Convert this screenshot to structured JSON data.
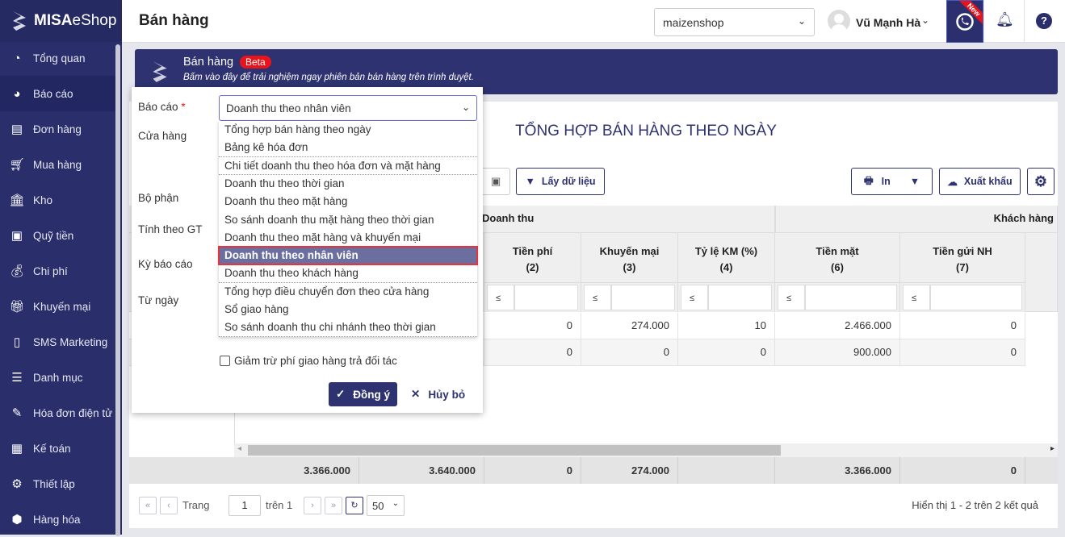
{
  "brand": {
    "logo_text_bold": "MISA",
    "logo_text": "eShop"
  },
  "sidebar": {
    "items": [
      {
        "label": "Tổng quan",
        "icon": "dashboard-icon"
      },
      {
        "label": "Báo cáo",
        "icon": "pie-chart-icon",
        "active": true
      },
      {
        "label": "Đơn hàng",
        "icon": "order-icon"
      },
      {
        "label": "Mua hàng",
        "icon": "cart-icon"
      },
      {
        "label": "Kho",
        "icon": "warehouse-icon"
      },
      {
        "label": "Quỹ tiền",
        "icon": "safe-icon"
      },
      {
        "label": "Chi phí",
        "icon": "money-bag-icon"
      },
      {
        "label": "Khuyến mại",
        "icon": "gift-icon"
      },
      {
        "label": "SMS Marketing",
        "icon": "phone-icon"
      },
      {
        "label": "Danh mục",
        "icon": "list-icon"
      },
      {
        "label": "Hóa đơn điện tử",
        "icon": "invoice-icon"
      },
      {
        "label": "Kế toán",
        "icon": "calculator-icon"
      },
      {
        "label": "Thiết lập",
        "icon": "gear-icon"
      },
      {
        "label": "Hàng hóa",
        "icon": "goods-icon"
      }
    ]
  },
  "header": {
    "title": "Bán hàng",
    "shop": "maizenshop",
    "user": "Vũ Mạnh Hà",
    "new_badge": "New"
  },
  "banner": {
    "title": "Bán hàng",
    "badge": "Beta",
    "subtitle": "Bấm vào đây để trải nghiệm ngay phiên bản bán hàng trên trình duyệt."
  },
  "report": {
    "title": "TỔNG HỢP BÁN HÀNG THEO NGÀY",
    "toolbar": {
      "fetch": "Lấy dữ liệu",
      "print": "In",
      "export": "Xuất khẩu"
    },
    "group_headers": [
      "Doanh thu",
      "Khách hàng"
    ],
    "columns": [
      {
        "name": "Tiền phí",
        "num": "(2)"
      },
      {
        "name": "Khuyến mại",
        "num": "(3)"
      },
      {
        "name": "Tỷ lệ KM (%)",
        "num": "(4)"
      },
      {
        "name": "Tiền mặt",
        "num": "(6)"
      },
      {
        "name": "Tiền gửi NH",
        "num": "(7)"
      }
    ],
    "filter_op": "≤",
    "rows": [
      [
        "0",
        "274.000",
        "10",
        "2.466.000",
        "0"
      ],
      [
        "0",
        "0",
        "0",
        "900.000",
        "0"
      ]
    ],
    "totals": [
      "3.366.000",
      "3.640.000",
      "0",
      "274.000",
      "",
      "3.366.000",
      "0"
    ],
    "pagination": {
      "page_label": "Trang",
      "page": "1",
      "of": "trên 1",
      "page_size": "50",
      "summary": "Hiển thị 1 - 2 trên 2 kết quả"
    }
  },
  "popup": {
    "labels": {
      "report": "Báo cáo",
      "store": "Cửa hàng",
      "dept": "Bộ phận",
      "value_by": "Tính theo GT",
      "period": "Kỳ báo cáo",
      "from": "Từ ngày"
    },
    "required_mark": "*",
    "selected": "Doanh thu theo nhân viên",
    "options": [
      "Tổng hợp bán hàng theo ngày",
      "Bảng kê hóa đơn",
      "Chi tiết doanh thu theo hóa đơn và mặt hàng",
      "Doanh thu theo thời gian",
      "Doanh thu theo mặt hàng",
      "So sánh doanh thu mặt hàng theo thời gian",
      "Doanh thu theo mặt hàng và khuyến mại",
      "Doanh thu theo nhân viên",
      "Doanh thu theo khách hàng",
      "Tổng hợp điều chuyển đơn theo cửa hàng",
      "Sổ giao hàng",
      "So sánh doanh thu chi nhánh theo thời gian"
    ],
    "checkbox": "Giảm trừ phí giao hàng trả đối tác",
    "ok": "Đồng ý",
    "cancel": "Hủy bỏ"
  }
}
